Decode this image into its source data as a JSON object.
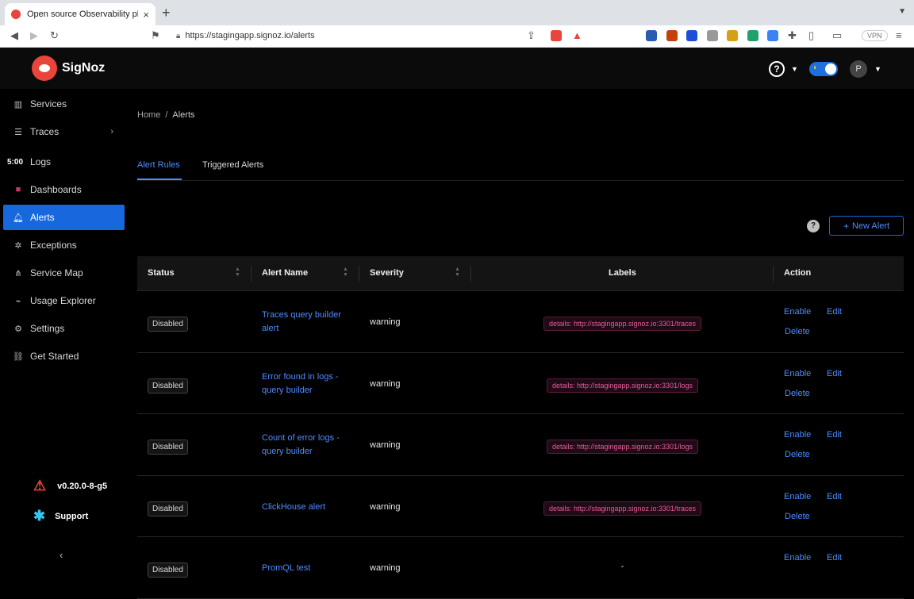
{
  "browser": {
    "tab_title": "Open source Observability platf",
    "tab_close": "×",
    "new_tab": "+",
    "url": "https://stagingapp.signoz.io/alerts",
    "vpn_label": "VPN"
  },
  "app": {
    "brand": "SigNoz",
    "help_symbol": "?",
    "avatar_initial": "P"
  },
  "sidebar": {
    "items": [
      {
        "label": "Services",
        "icon": "bar-chart-icon"
      },
      {
        "label": "Traces",
        "icon": "menu-icon"
      },
      {
        "label": "Logs",
        "icon": "clock-icon",
        "icon_text": "5:00"
      },
      {
        "label": "Dashboards",
        "icon": "dashboard-icon"
      },
      {
        "label": "Alerts",
        "icon": "bell-icon"
      },
      {
        "label": "Exceptions",
        "icon": "bug-icon"
      },
      {
        "label": "Service Map",
        "icon": "deployment-icon"
      },
      {
        "label": "Usage Explorer",
        "icon": "line-chart-icon"
      },
      {
        "label": "Settings",
        "icon": "gear-icon"
      },
      {
        "label": "Get Started",
        "icon": "link-icon"
      }
    ],
    "version": "v0.20.0-8-g5",
    "support": "Support"
  },
  "breadcrumb": {
    "home": "Home",
    "separator": "/",
    "current": "Alerts"
  },
  "tabs": {
    "alert_rules": "Alert Rules",
    "triggered_alerts": "Triggered Alerts"
  },
  "toolbar": {
    "help": "?",
    "new_alert": "New Alert",
    "new_alert_plus": "+"
  },
  "table": {
    "columns": {
      "status": "Status",
      "alert_name": "Alert Name",
      "severity": "Severity",
      "labels": "Labels",
      "action": "Action"
    },
    "actions": {
      "enable": "Enable",
      "edit": "Edit",
      "delete": "Delete"
    },
    "rows": [
      {
        "status": "Disabled",
        "name": "Traces query builder alert",
        "severity": "warning",
        "label": "details: http://stagingapp.signoz.io:3301/traces"
      },
      {
        "status": "Disabled",
        "name": "Error found in logs - query builder",
        "severity": "warning",
        "label": "details: http://stagingapp.signoz.io:3301/logs"
      },
      {
        "status": "Disabled",
        "name": "Count of error logs - query builder",
        "severity": "warning",
        "label": "details: http://stagingapp.signoz.io:3301/logs"
      },
      {
        "status": "Disabled",
        "name": "ClickHouse alert",
        "severity": "warning",
        "label": "details: http://stagingapp.signoz.io:3301/traces"
      },
      {
        "status": "Disabled",
        "name": "PromQL test",
        "severity": "warning",
        "label": "-"
      }
    ]
  },
  "colors": {
    "accent": "#1668dc",
    "link": "#4e8cff",
    "label_text": "#e85a9c",
    "brand_red": "#e8453c"
  }
}
